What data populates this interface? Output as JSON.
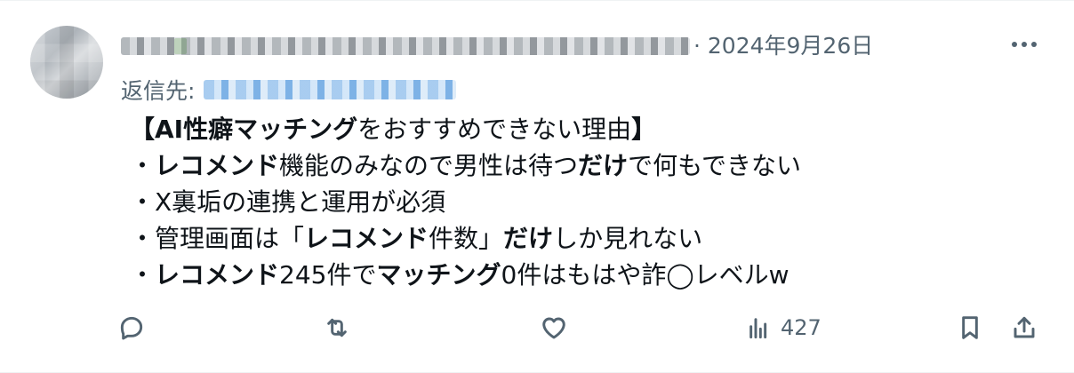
{
  "tweet": {
    "date": "· 2024年9月26日",
    "reply_label": "返信先:",
    "more_icon": "more-horizontal-icon",
    "body_lines": [
      [
        {
          "text": "【AI性癖マッチング",
          "bold": true
        },
        {
          "text": "をおすすめできない理由",
          "bold": false
        },
        {
          "text": "】",
          "bold": true
        }
      ],
      [
        {
          "text": "・",
          "bold": false
        },
        {
          "text": "レコメンド",
          "bold": true
        },
        {
          "text": "機能のみなので男性は待つ",
          "bold": false
        },
        {
          "text": "だけ",
          "bold": true
        },
        {
          "text": "で何もできない",
          "bold": false
        }
      ],
      [
        {
          "text": "・X裏垢の連携と運用が必須",
          "bold": false
        }
      ],
      [
        {
          "text": "・管理画面は「",
          "bold": false
        },
        {
          "text": "レコメンド",
          "bold": true
        },
        {
          "text": "件数」",
          "bold": false
        },
        {
          "text": "だけ",
          "bold": true
        },
        {
          "text": "しか見れない",
          "bold": false
        }
      ],
      [
        {
          "text": "・",
          "bold": false
        },
        {
          "text": "レコメンド",
          "bold": true
        },
        {
          "text": "245件で",
          "bold": false
        },
        {
          "text": "マッチング",
          "bold": true
        },
        {
          "text": "0件はもはや詐◯レベルw",
          "bold": false
        }
      ]
    ],
    "actions": {
      "reply_icon": "reply-icon",
      "retweet_icon": "retweet-icon",
      "like_icon": "heart-icon",
      "views_icon": "views-icon",
      "view_count": "427",
      "bookmark_icon": "bookmark-icon",
      "share_icon": "share-icon"
    },
    "colors": {
      "text": "#0f1419",
      "secondary": "#536471",
      "border": "#eff3f4"
    }
  }
}
